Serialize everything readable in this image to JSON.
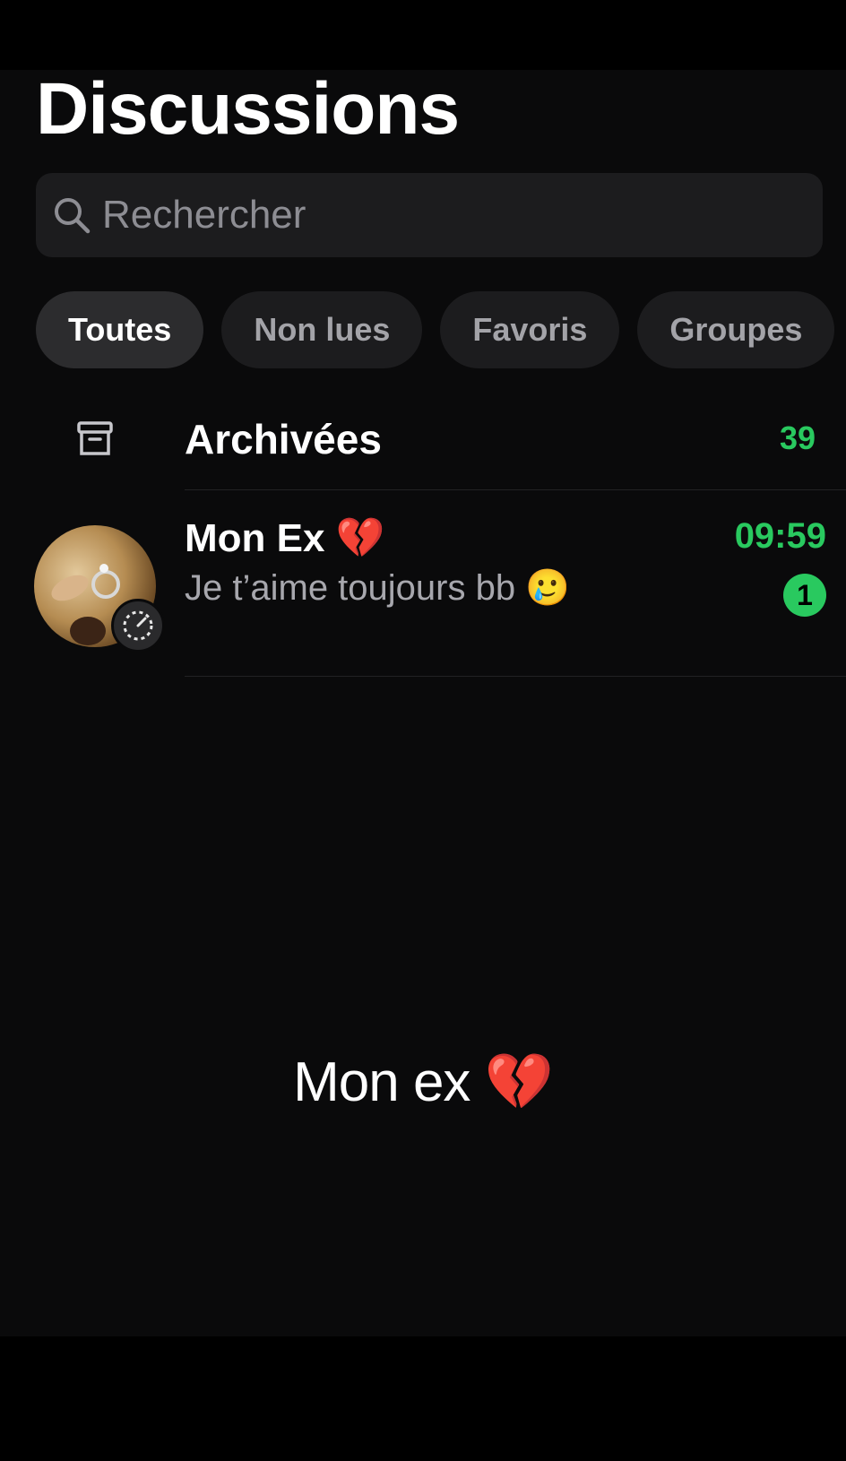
{
  "header": {
    "title": "Discussions"
  },
  "search": {
    "placeholder": "Rechercher",
    "icon": "search-icon"
  },
  "filters": [
    {
      "label": "Toutes",
      "active": true
    },
    {
      "label": "Non lues",
      "active": false
    },
    {
      "label": "Favoris",
      "active": false
    },
    {
      "label": "Groupes",
      "active": false
    }
  ],
  "archived": {
    "label": "Archivées",
    "count": "39",
    "icon": "archive-box-icon"
  },
  "chats": [
    {
      "name": "Mon Ex",
      "name_emoji": "💔",
      "preview": "Je t’aime toujours bb",
      "preview_emoji": "🥲",
      "time": "09:59",
      "unread": "1",
      "avatar": "ring-photo-avatar",
      "status_icon": "status-ring-icon"
    }
  ],
  "caption": {
    "text": "Mon ex",
    "emoji": "💔"
  },
  "colors": {
    "accent_green": "#29c95f",
    "background": "#0a0a0b",
    "chip_bg": "#1c1c1e"
  }
}
